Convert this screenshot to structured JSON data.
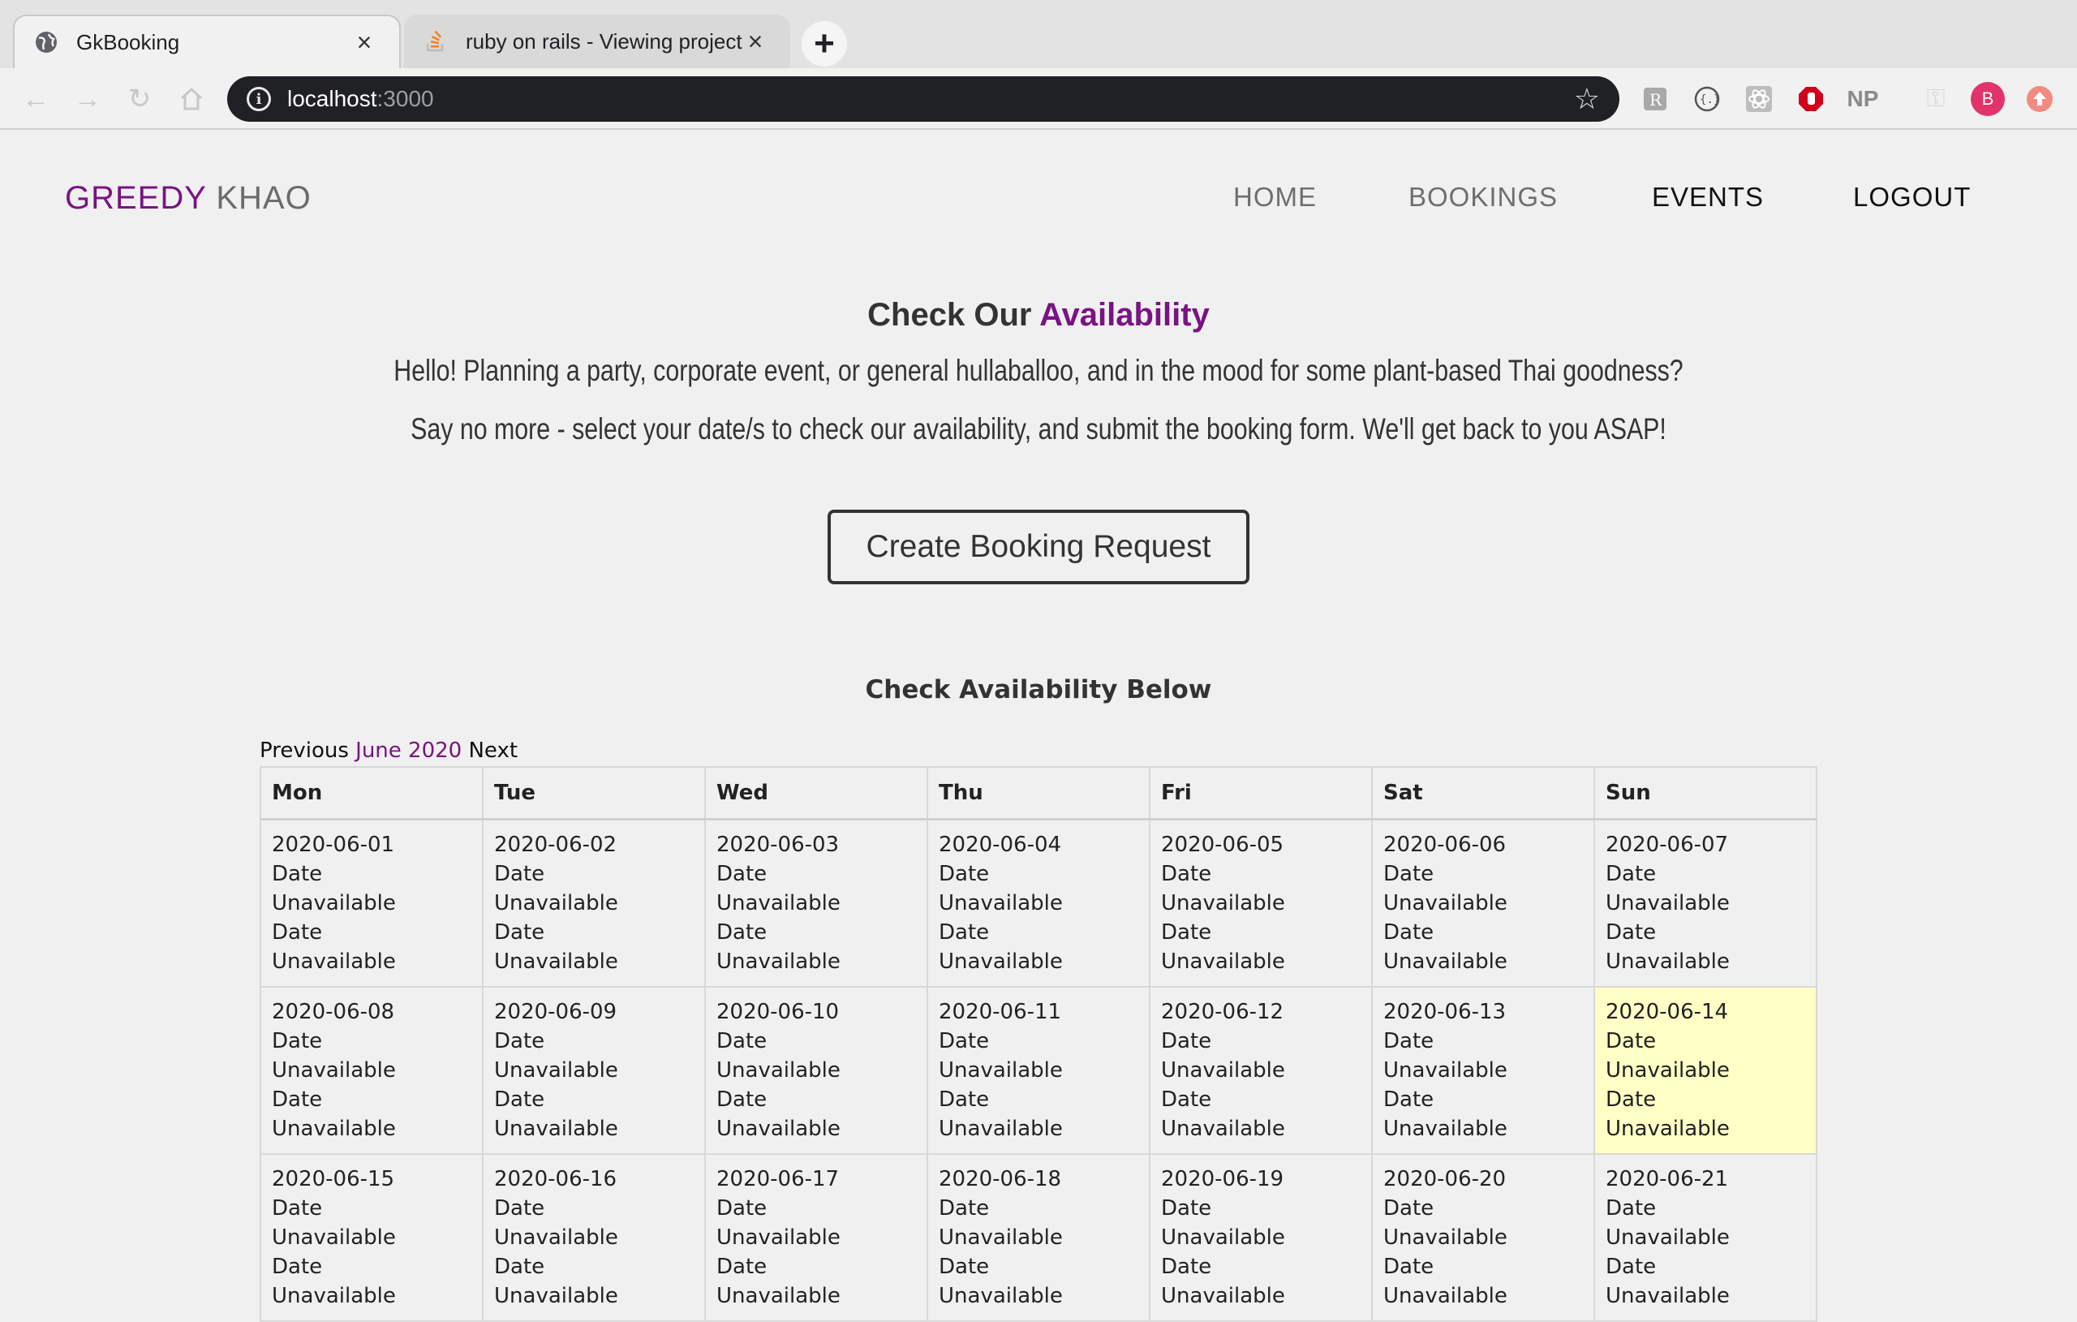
{
  "browser": {
    "tabs": [
      {
        "title": "GkBooking",
        "icon": "globe-icon"
      },
      {
        "title": "ruby on rails - Viewing project",
        "icon": "stackoverflow-icon"
      }
    ],
    "address": {
      "host": "localhost",
      "port": ":3000"
    },
    "extensions": [
      "rails-extension-icon",
      "json-extension-icon",
      "react-devtools-icon",
      "adblock-icon",
      "NP",
      "key-icon",
      "B",
      "update-icon"
    ]
  },
  "site": {
    "brand": {
      "first": "GREEDY",
      "second": "KHAO"
    },
    "nav": [
      "HOME",
      "BOOKINGS",
      "EVENTS",
      "LOGOUT"
    ],
    "heading": {
      "prefix": "Check Our",
      "accent": "Availability"
    },
    "lead1": "Hello! Planning a party, corporate event, or general hullaballoo, and in the mood for some plant-based Thai goodness?",
    "lead2": "Say no more - select your date/s to check our availability, and submit the booking form. We'll get back to you ASAP!",
    "cta": "Create Booking Request",
    "subheading": "Check Availability Below"
  },
  "calendar": {
    "prev": "Previous",
    "month": "June 2020",
    "next": "Next",
    "days": [
      "Mon",
      "Tue",
      "Wed",
      "Thu",
      "Fri",
      "Sat",
      "Sun"
    ],
    "status_lines": [
      "Date",
      "Unavailable",
      "Date",
      "Unavailable"
    ],
    "highlight": "2020-06-14",
    "weeks": [
      [
        "2020-06-01",
        "2020-06-02",
        "2020-06-03",
        "2020-06-04",
        "2020-06-05",
        "2020-06-06",
        "2020-06-07"
      ],
      [
        "2020-06-08",
        "2020-06-09",
        "2020-06-10",
        "2020-06-11",
        "2020-06-12",
        "2020-06-13",
        "2020-06-14"
      ],
      [
        "2020-06-15",
        "2020-06-16",
        "2020-06-17",
        "2020-06-18",
        "2020-06-19",
        "2020-06-20",
        "2020-06-21"
      ]
    ]
  }
}
